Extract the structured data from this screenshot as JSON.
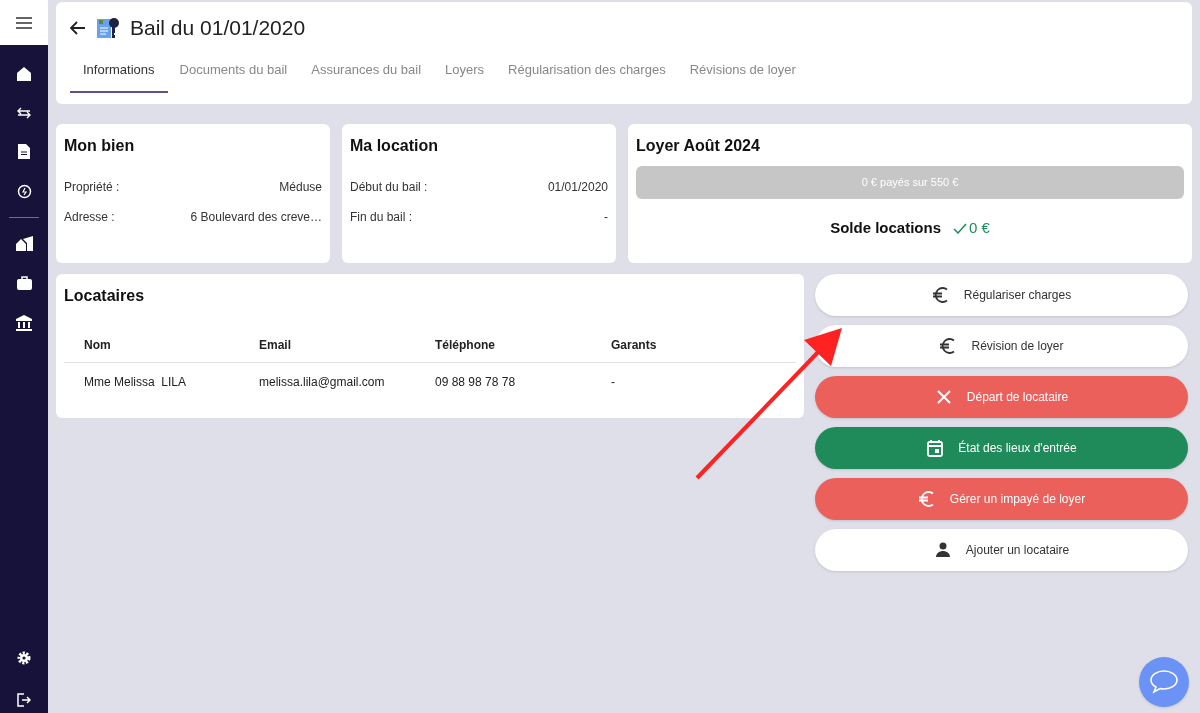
{
  "header": {
    "title": "Bail du 01/01/2020"
  },
  "tabs": [
    {
      "label": "Informations",
      "selected": true
    },
    {
      "label": "Documents du bail",
      "selected": false
    },
    {
      "label": "Assurances du bail",
      "selected": false
    },
    {
      "label": "Loyers",
      "selected": false
    },
    {
      "label": "Régularisation des charges",
      "selected": false
    },
    {
      "label": "Révisions de loyer",
      "selected": false
    }
  ],
  "property_card": {
    "title": "Mon bien",
    "rows": [
      {
        "label": "Propriété :",
        "value": "Méduse"
      },
      {
        "label": "Adresse :",
        "value": "6 Boulevard des creve…"
      }
    ]
  },
  "lease_card": {
    "title": "Ma location",
    "rows": [
      {
        "label": "Début du bail :",
        "value": "01/01/2020"
      },
      {
        "label": "Fin du bail :",
        "value": "-"
      }
    ]
  },
  "rent_card": {
    "title": "Loyer Août 2024",
    "progress": {
      "text": "0 € payés sur 550 €",
      "level": 0
    },
    "balance_label": "Solde locations",
    "balance_value": "0 €"
  },
  "tenants": {
    "title": "Locataires",
    "columns": [
      "Nom",
      "Email",
      "Téléphone",
      "Garants"
    ],
    "rows": [
      [
        "Mme Melissa  LILA",
        "melissa.lila@gmail.com",
        "09 88 98 78 78",
        "-"
      ]
    ]
  },
  "actions": [
    {
      "label": "Régulariser charges",
      "kind": "charges"
    },
    {
      "label": "Révision de loyer",
      "kind": "revision"
    },
    {
      "label": "Départ de locataire",
      "kind": "departure"
    },
    {
      "label": "État des lieux d'entrée",
      "kind": "inventory"
    },
    {
      "label": "Gérer un impayé de loyer",
      "kind": "unpaid"
    },
    {
      "label": "Ajouter un locataire",
      "kind": "tenant"
    }
  ]
}
